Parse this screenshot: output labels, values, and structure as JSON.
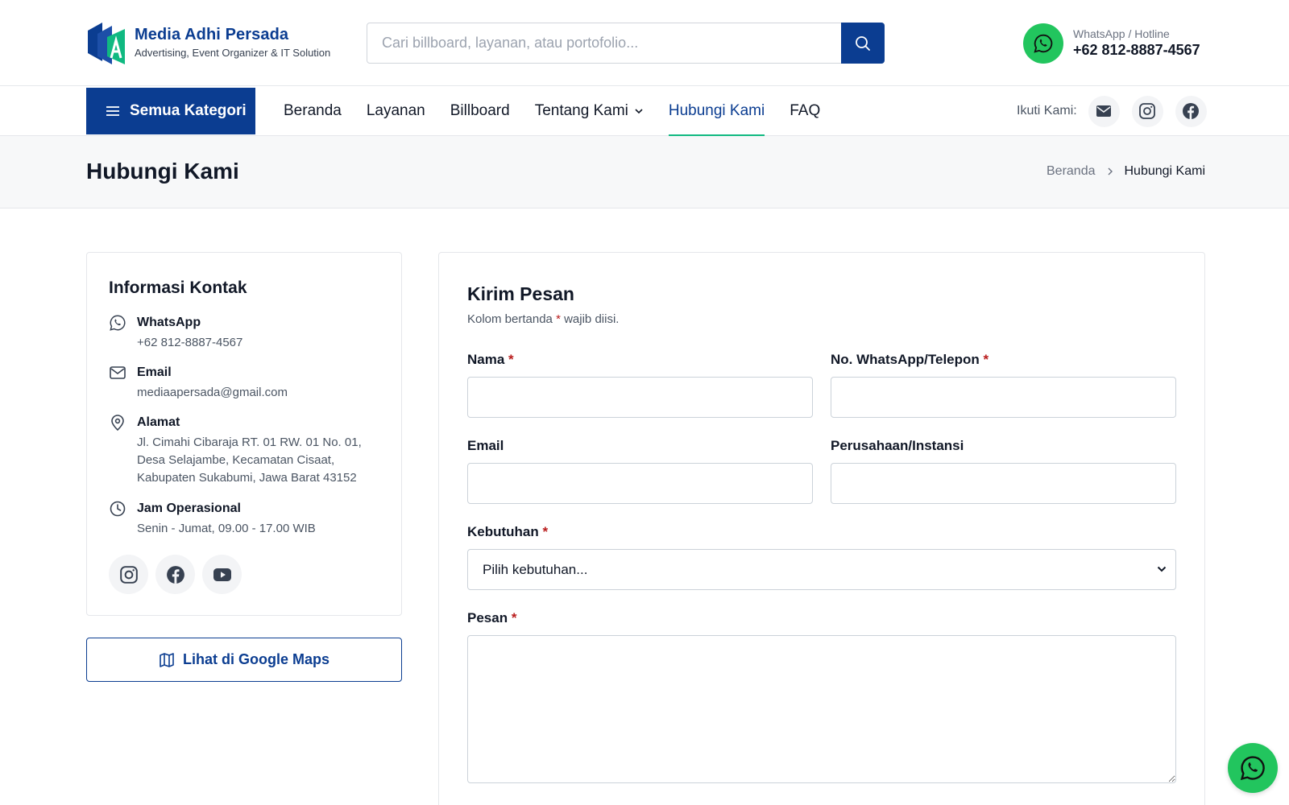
{
  "header": {
    "brand_name": "Media Adhi Persada",
    "brand_tagline": "Advertising, Event Organizer & IT Solution",
    "search_placeholder": "Cari billboard, layanan, atau portofolio...",
    "hotline_label": "WhatsApp / Hotline",
    "hotline_number": "+62 812-8887-4567"
  },
  "nav": {
    "all_categories": "Semua Kategori",
    "items": [
      {
        "label": "Beranda"
      },
      {
        "label": "Layanan"
      },
      {
        "label": "Billboard"
      },
      {
        "label": "Tentang Kami"
      },
      {
        "label": "Hubungi Kami"
      },
      {
        "label": "FAQ"
      }
    ],
    "active_item": "Hubungi Kami",
    "follow_label": "Ikuti Kami:",
    "social_icons": [
      "envelope-icon",
      "instagram-icon",
      "facebook-icon"
    ]
  },
  "page": {
    "title": "Hubungi Kami",
    "breadcrumb": {
      "home": "Beranda",
      "current": "Hubungi Kami"
    }
  },
  "contact_info": {
    "title": "Informasi Kontak",
    "whatsapp": {
      "label": "WhatsApp",
      "value": "+62 812-8887-4567"
    },
    "email": {
      "label": "Email",
      "value": "mediaapersada@gmail.com"
    },
    "address": {
      "label": "Alamat",
      "value": "Jl. Cimahi Cibaraja RT. 01 RW. 01 No. 01, Desa Selajambe, Kecamatan Cisaat, Kabupaten Sukabumi, Jawa Barat 43152"
    },
    "hours": {
      "label": "Jam Operasional",
      "value": "Senin - Jumat, 09.00 - 17.00 WIB"
    },
    "social_icons": [
      "instagram-icon",
      "facebook-icon",
      "youtube-icon"
    ],
    "maps_button": "Lihat di Google Maps"
  },
  "form": {
    "title": "Kirim Pesan",
    "note_before": "Kolom bertanda ",
    "note_star": "*",
    "note_after": " wajib diisi.",
    "fields": {
      "name": "Nama",
      "phone": "No. WhatsApp/Telepon",
      "email": "Email",
      "company": "Perusahaan/Instansi",
      "need": "Kebutuhan",
      "message": "Pesan"
    },
    "required_mark": "*",
    "need_selected": "Pilih kebutuhan..."
  },
  "colors": {
    "primary": "#0b3d91",
    "accent_green": "#22c55e",
    "active_underline": "#10b981",
    "required": "#b91c1c"
  }
}
